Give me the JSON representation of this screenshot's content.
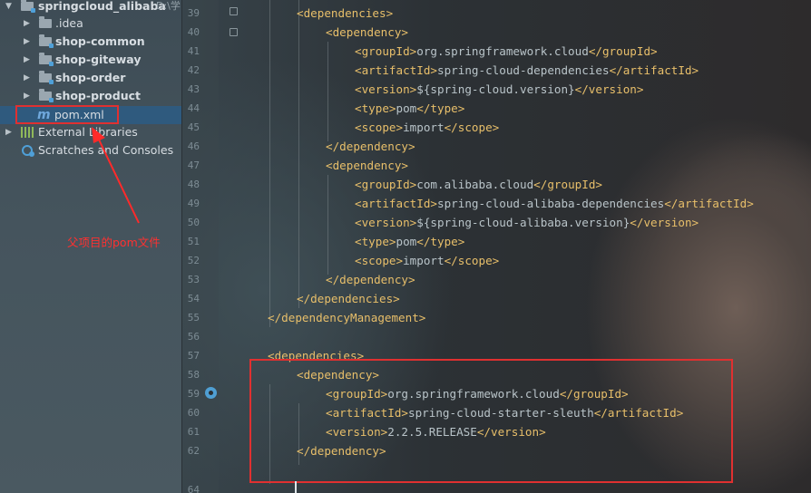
{
  "project_tree": {
    "root": {
      "label": "springcloud_alibaba",
      "path_hint": "D:\\学"
    },
    "items": [
      {
        "label": ".idea"
      },
      {
        "label": "shop-common"
      },
      {
        "label": "shop-giteway"
      },
      {
        "label": "shop-order"
      },
      {
        "label": "shop-product"
      },
      {
        "label": "pom.xml",
        "icon": "m"
      }
    ],
    "external_libraries": "External Libraries",
    "scratches": "Scratches and Consoles"
  },
  "annotation": {
    "text": "父项目的pom文件",
    "color": "#ff3030"
  },
  "editor": {
    "lines": [
      {
        "number": "39",
        "indent": 4,
        "parts": [
          [
            "tag",
            "<dependencies>"
          ]
        ]
      },
      {
        "number": "40",
        "indent": 6,
        "parts": [
          [
            "tag",
            "<dependency>"
          ]
        ]
      },
      {
        "number": "41",
        "indent": 8,
        "parts": [
          [
            "tag",
            "<groupId>"
          ],
          [
            "txt",
            "org.springframework.cloud"
          ],
          [
            "tag",
            "</groupId>"
          ]
        ]
      },
      {
        "number": "42",
        "indent": 8,
        "parts": [
          [
            "tag",
            "<artifactId>"
          ],
          [
            "txt",
            "spring-cloud-dependencies"
          ],
          [
            "tag",
            "</artifactId>"
          ]
        ]
      },
      {
        "number": "43",
        "indent": 8,
        "parts": [
          [
            "tag",
            "<version>"
          ],
          [
            "txt",
            "${spring-cloud.version}"
          ],
          [
            "tag",
            "</version>"
          ]
        ]
      },
      {
        "number": "44",
        "indent": 8,
        "parts": [
          [
            "tag",
            "<type>"
          ],
          [
            "txt",
            "pom"
          ],
          [
            "tag",
            "</type>"
          ]
        ]
      },
      {
        "number": "45",
        "indent": 8,
        "parts": [
          [
            "tag",
            "<scope>"
          ],
          [
            "txt",
            "import"
          ],
          [
            "tag",
            "</scope>"
          ]
        ]
      },
      {
        "number": "46",
        "indent": 6,
        "parts": [
          [
            "tag",
            "</dependency>"
          ]
        ]
      },
      {
        "number": "47",
        "indent": 6,
        "parts": [
          [
            "tag",
            "<dependency>"
          ]
        ]
      },
      {
        "number": "48",
        "indent": 8,
        "parts": [
          [
            "tag",
            "<groupId>"
          ],
          [
            "txt",
            "com.alibaba.cloud"
          ],
          [
            "tag",
            "</groupId>"
          ]
        ]
      },
      {
        "number": "49",
        "indent": 8,
        "parts": [
          [
            "tag",
            "<artifactId>"
          ],
          [
            "txt",
            "spring-cloud-alibaba-dependencies"
          ],
          [
            "tag",
            "</artifactId>"
          ]
        ]
      },
      {
        "number": "50",
        "indent": 8,
        "parts": [
          [
            "tag",
            "<version>"
          ],
          [
            "txt",
            "${spring-cloud-alibaba.version}"
          ],
          [
            "tag",
            "</version>"
          ]
        ]
      },
      {
        "number": "51",
        "indent": 8,
        "parts": [
          [
            "tag",
            "<type>"
          ],
          [
            "txt",
            "pom"
          ],
          [
            "tag",
            "</type>"
          ]
        ]
      },
      {
        "number": "52",
        "indent": 8,
        "parts": [
          [
            "tag",
            "<scope>"
          ],
          [
            "txt",
            "import"
          ],
          [
            "tag",
            "</scope>"
          ]
        ]
      },
      {
        "number": "53",
        "indent": 6,
        "parts": [
          [
            "tag",
            "</dependency>"
          ]
        ]
      },
      {
        "number": "54",
        "indent": 4,
        "parts": [
          [
            "tag",
            "</dependencies>"
          ]
        ]
      },
      {
        "number": "55",
        "indent": 2,
        "parts": [
          [
            "tag",
            "</dependencyManagement>"
          ]
        ]
      },
      {
        "number": "56",
        "indent": 0,
        "parts": []
      },
      {
        "number": "57",
        "indent": 2,
        "parts": [
          [
            "tag",
            "<dependencies>"
          ]
        ]
      },
      {
        "number": "58",
        "indent": 4,
        "parts": [
          [
            "tag",
            "<dependency>"
          ]
        ]
      },
      {
        "number": "59",
        "indent": 6,
        "parts": [
          [
            "tag",
            "<groupId>"
          ],
          [
            "txt",
            "org.springframework.cloud"
          ],
          [
            "tag",
            "</groupId>"
          ]
        ]
      },
      {
        "number": "60",
        "indent": 6,
        "parts": [
          [
            "tag",
            "<artifactId>"
          ],
          [
            "txt",
            "spring-cloud-starter-sleuth"
          ],
          [
            "tag",
            "</artifactId>"
          ]
        ]
      },
      {
        "number": "61",
        "indent": 6,
        "parts": [
          [
            "tag",
            "<version>"
          ],
          [
            "txt",
            "2.2.5.RELEASE"
          ],
          [
            "tag",
            "</version>"
          ]
        ]
      },
      {
        "number": "62",
        "indent": 4,
        "parts": [
          [
            "tag",
            "</dependency>"
          ]
        ]
      },
      {
        "number": "64",
        "indent": 0,
        "parts": []
      }
    ]
  },
  "colors": {
    "tag": "#e8bf6a",
    "text": "#b9c4c9",
    "highlight_border": "#e03030",
    "selection": "#2f5a7e"
  }
}
